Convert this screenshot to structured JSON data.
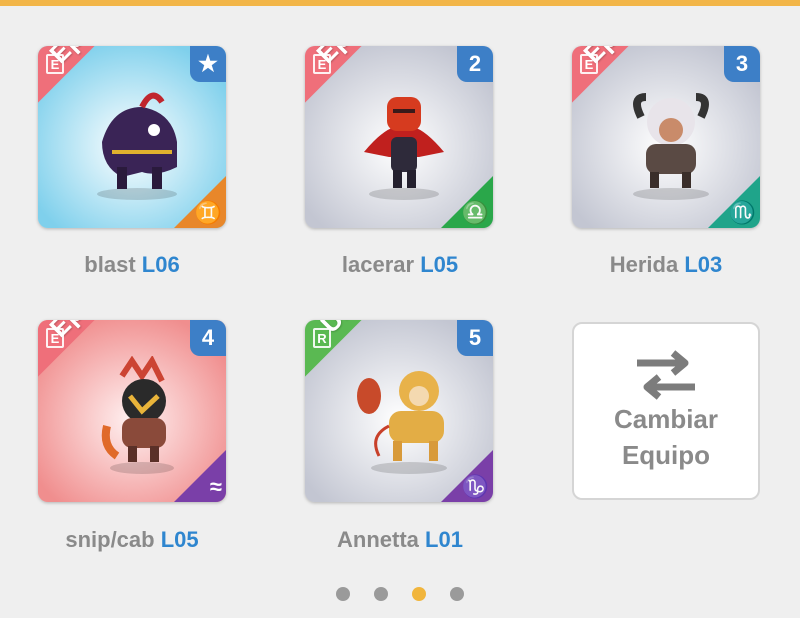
{
  "cards": [
    {
      "rarity": "Épico",
      "rarity_letter": "E",
      "badge": "★",
      "zodiac": "♊",
      "name": "blast",
      "level": "L06"
    },
    {
      "rarity": "Épico",
      "rarity_letter": "E",
      "badge": "2",
      "zodiac": "♎",
      "name": "lacerar",
      "level": "L05"
    },
    {
      "rarity": "Épico",
      "rarity_letter": "E",
      "badge": "3",
      "zodiac": "♏",
      "name": "Herida",
      "level": "L03"
    },
    {
      "rarity": "Épico",
      "rarity_letter": "E",
      "badge": "4",
      "zodiac": "≈",
      "name": "snip/cab",
      "level": "L05"
    },
    {
      "rarity": "Ultra",
      "rarity_letter": "R",
      "badge": "5",
      "zodiac": "♑",
      "name": "Annetta",
      "level": "L01"
    }
  ],
  "swap": {
    "line1": "Cambiar",
    "line2": "Equipo",
    "icon": "swap-arrows-icon"
  },
  "pagination": {
    "count": 4,
    "active_index": 2
  },
  "colors": {
    "accent_bar": "#f2b548",
    "level_text": "#2f86cf",
    "epic_ribbon": "#ef6f7a",
    "ultra_ribbon": "#5ab952",
    "badge_blue": "#3d7fc7",
    "dot_active": "#f1b53c"
  }
}
